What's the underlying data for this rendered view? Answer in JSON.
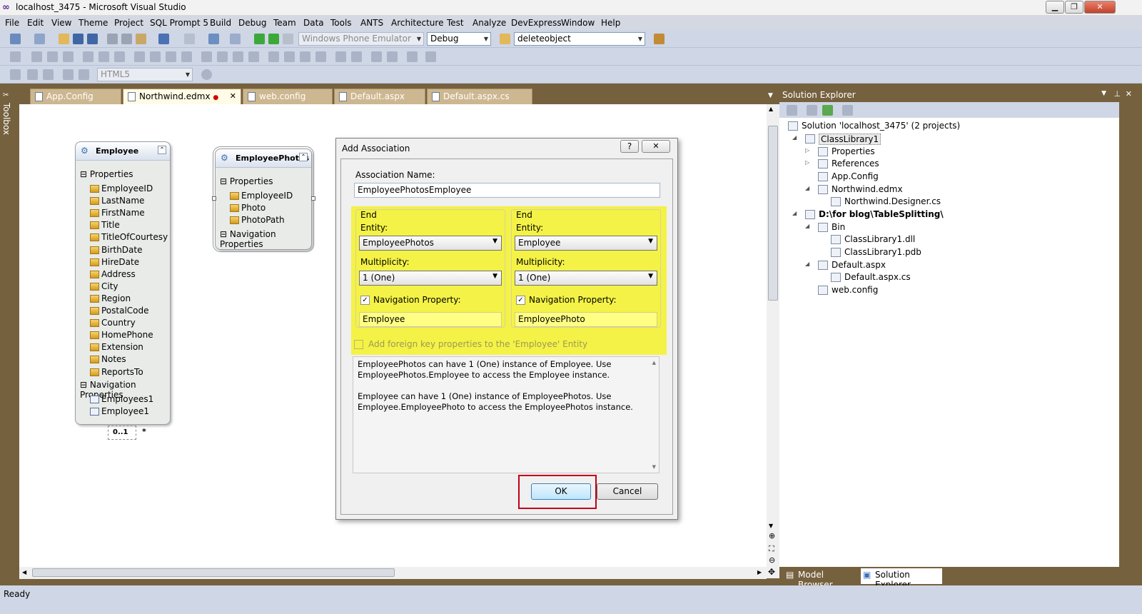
{
  "window": {
    "title": "localhost_3475 - Microsoft Visual Studio"
  },
  "menu": [
    "File",
    "Edit",
    "View",
    "Theme",
    "Project",
    "SQL Prompt 5",
    "Build",
    "Debug",
    "Team",
    "Data",
    "Tools",
    "ANTS",
    "Architecture",
    "Test",
    "Analyze",
    "DevExpress",
    "Window",
    "Help"
  ],
  "toolbar": {
    "platform": "Windows Phone Emulator",
    "config": "Debug",
    "find": "deleteobject",
    "html_target": "HTML5"
  },
  "toolbox_label": "Toolbox",
  "tabs": [
    {
      "label": "App.Config"
    },
    {
      "label": "Northwind.edmx",
      "modified": "●"
    },
    {
      "label": "web.config"
    },
    {
      "label": "Default.aspx"
    },
    {
      "label": "Default.aspx.cs"
    }
  ],
  "entities": {
    "employee": {
      "name": "Employee",
      "props_header": "Properties",
      "props": [
        "EmployeeID",
        "LastName",
        "FirstName",
        "Title",
        "TitleOfCourtesy",
        "BirthDate",
        "HireDate",
        "Address",
        "City",
        "Region",
        "PostalCode",
        "Country",
        "HomePhone",
        "Extension",
        "Notes",
        "ReportsTo"
      ],
      "nav_header": "Navigation Properties",
      "nav": [
        "Employees1",
        "Employee1"
      ],
      "assoc_multiplicity": "0..1",
      "assoc_other": "*"
    },
    "photos": {
      "name": "EmployeePhotos",
      "props_header": "Properties",
      "props": [
        "EmployeeID",
        "Photo",
        "PhotoPath"
      ],
      "nav_header": "Navigation Properties"
    }
  },
  "dialog": {
    "title": "Add Association",
    "help": "?",
    "close": "✕",
    "name_label": "Association Name:",
    "name_value": "EmployeePhotosEmployee",
    "end_left": {
      "end": "End",
      "entity_label": "Entity:",
      "entity": "EmployeePhotos",
      "mult_label": "Multiplicity:",
      "mult": "1 (One)",
      "nav_label": "Navigation Property:",
      "nav": "Employee"
    },
    "end_right": {
      "end": "End",
      "entity_label": "Entity:",
      "entity": "Employee",
      "mult_label": "Multiplicity:",
      "mult": "1 (One)",
      "nav_label": "Navigation Property:",
      "nav": "EmployeePhoto"
    },
    "fk_label": "Add foreign key properties to the 'Employee' Entity",
    "desc1": "EmployeePhotos can have 1 (One) instance of Employee. Use EmployeePhotos.Employee to access the Employee instance.",
    "desc2": "Employee can have 1 (One) instance of EmployeePhotos. Use Employee.EmployeePhoto to access the EmployeePhotos instance.",
    "ok": "OK",
    "cancel": "Cancel"
  },
  "solution": {
    "caption": "Solution Explorer",
    "nodes": [
      "Solution 'localhost_3475' (2 projects)",
      "ClassLibrary1",
      "Properties",
      "References",
      "App.Config",
      "Northwind.edmx",
      "Northwind.Designer.cs",
      "D:\\for blog\\TableSplitting\\",
      "Bin",
      "ClassLibrary1.dll",
      "ClassLibrary1.pdb",
      "Default.aspx",
      "Default.aspx.cs",
      "web.config"
    ],
    "bottom_tabs": [
      "Model Browser",
      "Solution Explorer"
    ]
  },
  "status": "Ready"
}
